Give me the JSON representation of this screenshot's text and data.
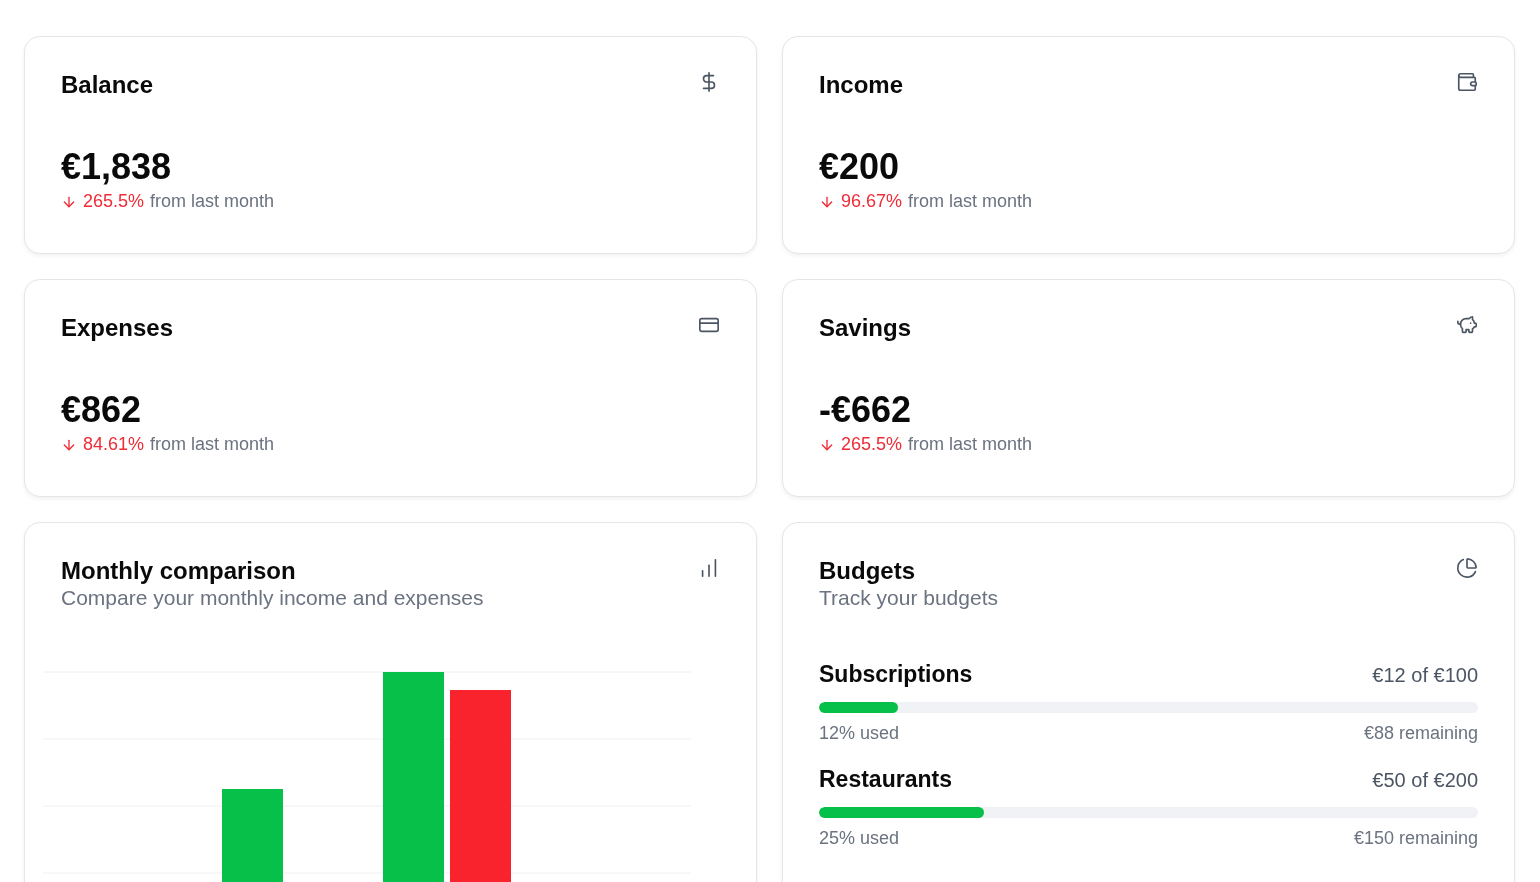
{
  "stats": [
    {
      "title": "Balance",
      "value": "€1,838",
      "change": "265.5%",
      "note": "from last month"
    },
    {
      "title": "Income",
      "value": "€200",
      "change": "96.67%",
      "note": "from last month"
    },
    {
      "title": "Expenses",
      "value": "€862",
      "change": "84.61%",
      "note": "from last month"
    },
    {
      "title": "Savings",
      "value": "-€662",
      "change": "265.5%",
      "note": "from last month"
    }
  ],
  "comparison": {
    "title": "Monthly comparison",
    "subtitle": "Compare your monthly income and expenses"
  },
  "budgets": {
    "title": "Budgets",
    "subtitle": "Track your budgets",
    "items": [
      {
        "name": "Subscriptions",
        "amount": "€12 of €100",
        "level": 0.12,
        "used": "12% used",
        "remaining": "€88 remaining"
      },
      {
        "name": "Restaurants",
        "amount": "€50 of €200",
        "level": 0.25,
        "used": "25% used",
        "remaining": "€150 remaining"
      }
    ]
  }
}
